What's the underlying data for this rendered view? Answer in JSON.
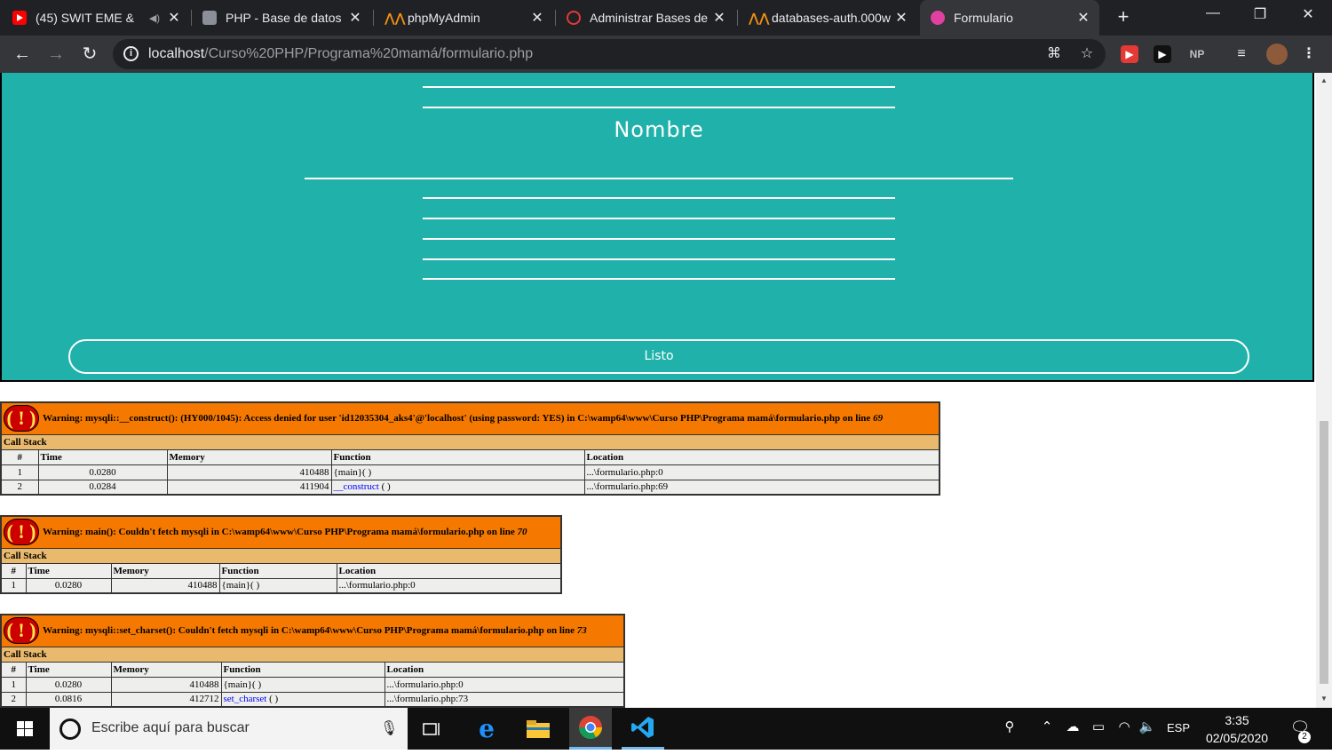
{
  "browser": {
    "tabs": [
      {
        "title": "(45) SWIT EME &",
        "favicon_color": "#ff0000",
        "favicon": "youtube-icon"
      },
      {
        "title": "PHP - Base de datos",
        "favicon_color": "#8a8f98",
        "favicon": "page-icon"
      },
      {
        "title": "phpMyAdmin",
        "favicon_color": "#f29111",
        "favicon": "phpmyadmin-icon"
      },
      {
        "title": "Administrar Bases de",
        "favicon_color": "#e53935",
        "favicon": "000webhost-icon"
      },
      {
        "title": "databases-auth.000w",
        "favicon_color": "#f29111",
        "favicon": "phpmyadmin-icon"
      },
      {
        "title": "Formulario",
        "favicon_color": "#e040a0",
        "favicon": "form-icon"
      }
    ],
    "active_tab": 5,
    "url_host": "localhost",
    "url_path": "/Curso%20PHP/Programa%20mamá/formulario.php"
  },
  "form": {
    "nombre_label": "Nombre",
    "submit_label": "Listo",
    "background": "#20b2aa"
  },
  "errors": [
    {
      "message": "Warning: mysqli::__construct(): (HY000/1045): Access denied for user 'id12035304_aks4'@'localhost' (using password: YES) in C:\\wamp64\\www\\Curso PHP\\Programa mamá\\formulario.php on line ",
      "line": "69",
      "call_stack_label": "Call Stack",
      "columns": [
        "#",
        "Time",
        "Memory",
        "Function",
        "Location"
      ],
      "rows": [
        {
          "n": "1",
          "time": "0.0280",
          "memory": "410488",
          "function": "{main}( )",
          "function_link": "",
          "function_suffix": "",
          "location": "...\\formulario.php:0"
        },
        {
          "n": "2",
          "time": "0.0284",
          "memory": "411904",
          "function": "",
          "function_link": "__construct",
          "function_suffix": " ( )",
          "location": "...\\formulario.php:69"
        }
      ]
    },
    {
      "message": "Warning: main(): Couldn't fetch mysqli in C:\\wamp64\\www\\Curso PHP\\Programa mamá\\formulario.php on line ",
      "line": "70",
      "call_stack_label": "Call Stack",
      "columns": [
        "#",
        "Time",
        "Memory",
        "Function",
        "Location"
      ],
      "rows": [
        {
          "n": "1",
          "time": "0.0280",
          "memory": "410488",
          "function": "{main}( )",
          "function_link": "",
          "function_suffix": "",
          "location": "...\\formulario.php:0"
        }
      ]
    },
    {
      "message": "Warning: mysqli::set_charset(): Couldn't fetch mysqli in C:\\wamp64\\www\\Curso PHP\\Programa mamá\\formulario.php on line ",
      "line": "73",
      "call_stack_label": "Call Stack",
      "columns": [
        "#",
        "Time",
        "Memory",
        "Function",
        "Location"
      ],
      "rows": [
        {
          "n": "1",
          "time": "0.0280",
          "memory": "410488",
          "function": "{main}( )",
          "function_link": "",
          "function_suffix": "",
          "location": "...\\formulario.php:0"
        },
        {
          "n": "2",
          "time": "0.0816",
          "memory": "412712",
          "function": "",
          "function_link": "set_charset",
          "function_suffix": " ( )",
          "location": "...\\formulario.php:73"
        }
      ]
    }
  ],
  "taskbar": {
    "search_placeholder": "Escribe aquí para buscar",
    "language": "ESP",
    "time": "3:35",
    "date": "02/05/2020",
    "notification_count": "2"
  }
}
